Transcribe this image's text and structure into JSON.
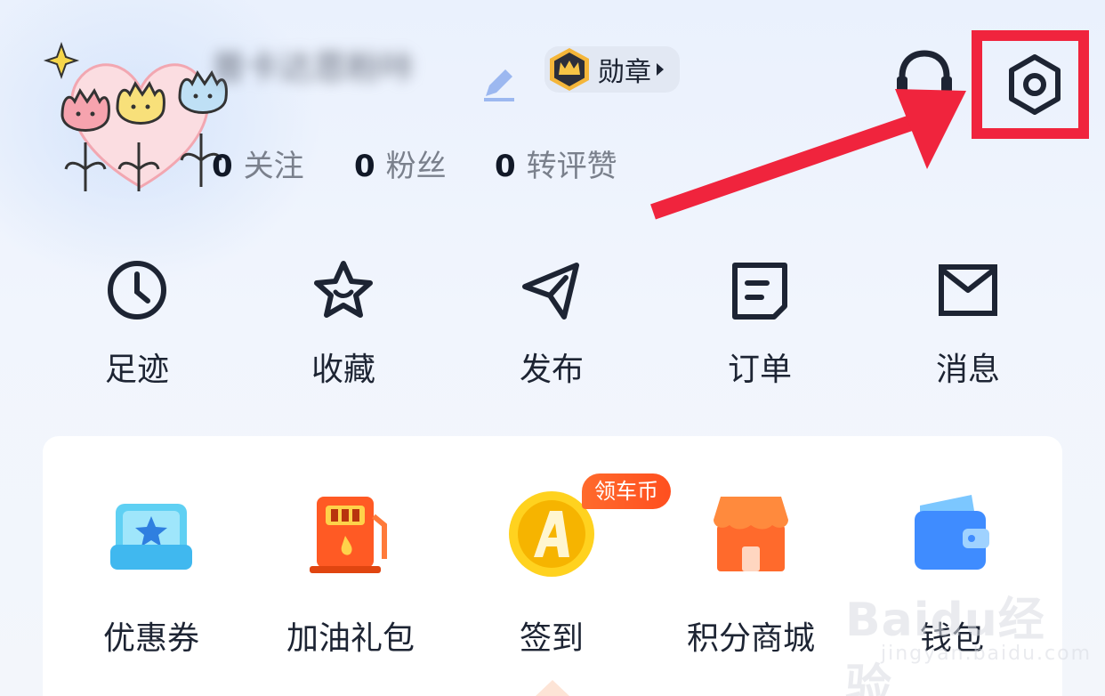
{
  "profile": {
    "username": "普卡达恩粉咔",
    "badge_label": "勋章",
    "stats": [
      {
        "num": "0",
        "label": "关注"
      },
      {
        "num": "0",
        "label": "粉丝"
      },
      {
        "num": "0",
        "label": "转评赞"
      }
    ]
  },
  "quick_actions": [
    {
      "label": "足迹",
      "icon": "clock-icon"
    },
    {
      "label": "收藏",
      "icon": "star-icon"
    },
    {
      "label": "发布",
      "icon": "paper-plane-icon"
    },
    {
      "label": "订单",
      "icon": "order-icon"
    },
    {
      "label": "消息",
      "icon": "mail-icon"
    }
  ],
  "services": [
    {
      "label": "优惠券",
      "icon": "coupon-icon"
    },
    {
      "label": "加油礼包",
      "icon": "fuel-pump-icon"
    },
    {
      "label": "签到",
      "icon": "coin-icon"
    },
    {
      "label": "积分商城",
      "icon": "shop-icon"
    },
    {
      "label": "钱包",
      "icon": "wallet-icon"
    }
  ],
  "promo_badge": "领车币",
  "watermark": {
    "main": "Baidu经验",
    "sub": "jingyan.baidu.com"
  },
  "colors": {
    "accent_red": "#f0243d",
    "promo_orange": "#ff5a24",
    "icon_dark": "#1d2433"
  }
}
